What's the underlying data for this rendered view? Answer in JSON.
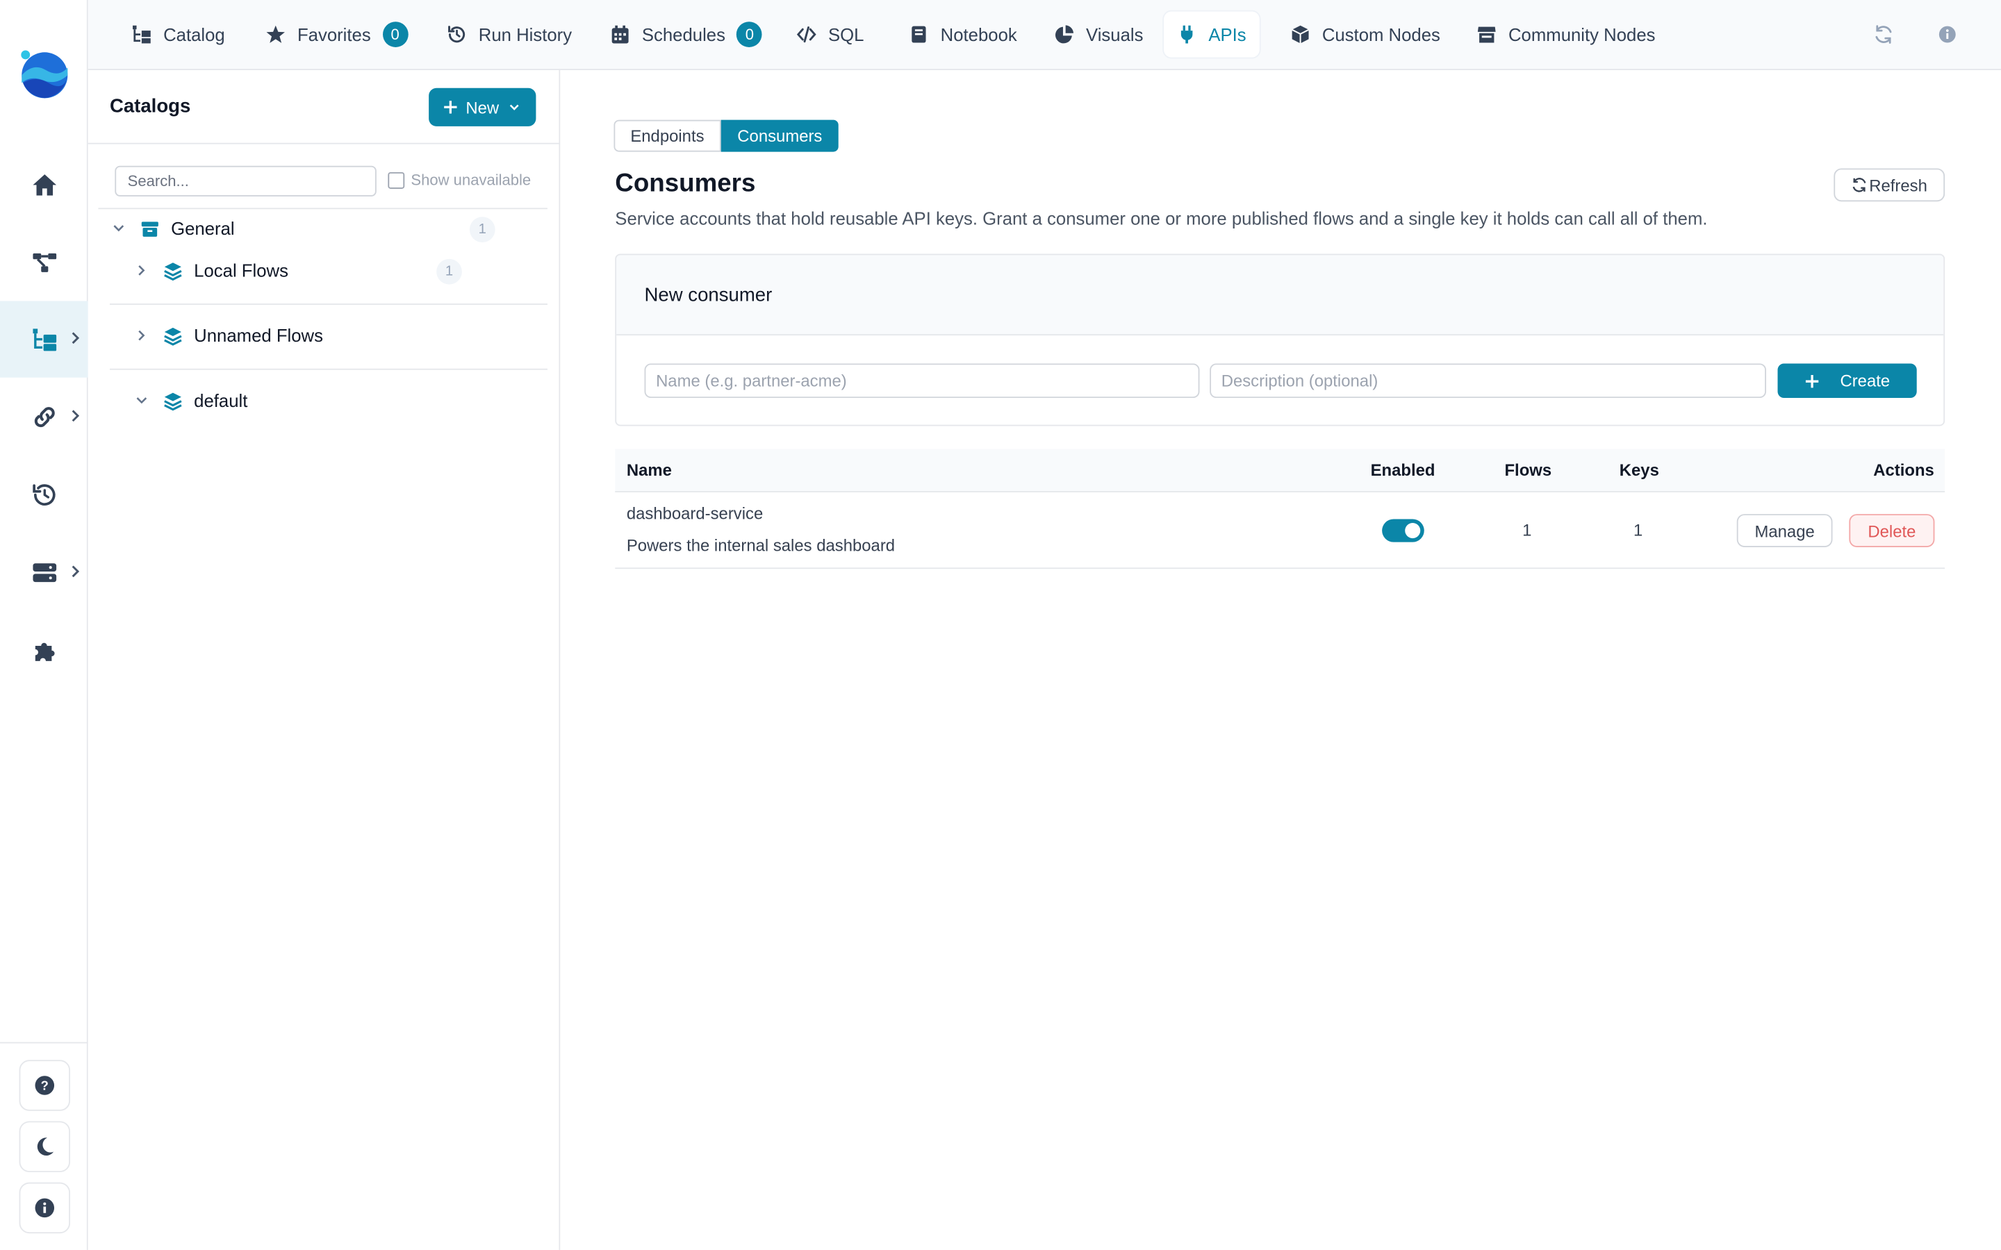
{
  "nav": {
    "tabs": [
      {
        "label": "Catalog",
        "icon": "catalog-icon"
      },
      {
        "label": "Favorites",
        "icon": "star-icon",
        "badge": "0"
      },
      {
        "label": "Run History",
        "icon": "history-icon"
      },
      {
        "label": "Schedules",
        "icon": "calendar-icon",
        "badge": "0"
      },
      {
        "label": "SQL",
        "icon": "code-icon"
      },
      {
        "label": "Notebook",
        "icon": "book-icon"
      },
      {
        "label": "Visuals",
        "icon": "pie-chart-icon"
      },
      {
        "label": "APIs",
        "icon": "plug-icon",
        "active": true
      },
      {
        "label": "Custom Nodes",
        "icon": "cube-icon"
      },
      {
        "label": "Community Nodes",
        "icon": "store-icon"
      }
    ]
  },
  "rail": {
    "items": [
      "home-icon",
      "flow-graph-icon",
      "catalog-tree-icon",
      "link-icon",
      "history-icon",
      "server-icon",
      "puzzle-icon"
    ],
    "active_item": "catalog-tree-icon",
    "bottom": [
      "help-icon",
      "moon-icon",
      "info-icon"
    ]
  },
  "catalog": {
    "title": "Catalogs",
    "new_label": "New",
    "search_placeholder": "Search...",
    "show_unavailable": "Show unavailable",
    "tree": {
      "general": {
        "label": "General",
        "count": "1"
      },
      "local_flows": {
        "label": "Local Flows",
        "count": "1"
      },
      "unnamed_flows": {
        "label": "Unnamed Flows"
      },
      "default": {
        "label": "default"
      }
    }
  },
  "main": {
    "segments": [
      "Endpoints",
      "Consumers"
    ],
    "active_segment": "Consumers",
    "title": "Consumers",
    "description": "Service accounts that hold reusable API keys. Grant a consumer one or more published flows and a single key it holds can call all of them.",
    "refresh_label": "Refresh",
    "new_consumer": {
      "title": "New consumer",
      "name_placeholder": "Name (e.g. partner-acme)",
      "description_placeholder": "Description (optional)",
      "create_label": "Create"
    },
    "table": {
      "columns": {
        "name": "Name",
        "enabled": "Enabled",
        "flows": "Flows",
        "keys": "Keys",
        "actions": "Actions"
      },
      "rows": [
        {
          "name": "dashboard-service",
          "description": "Powers the internal sales dashboard",
          "enabled": true,
          "flows": "1",
          "keys": "1",
          "manage": "Manage",
          "delete": "Delete"
        }
      ]
    }
  },
  "colors": {
    "accent": "#0b86a8",
    "danger": "#e05757"
  }
}
